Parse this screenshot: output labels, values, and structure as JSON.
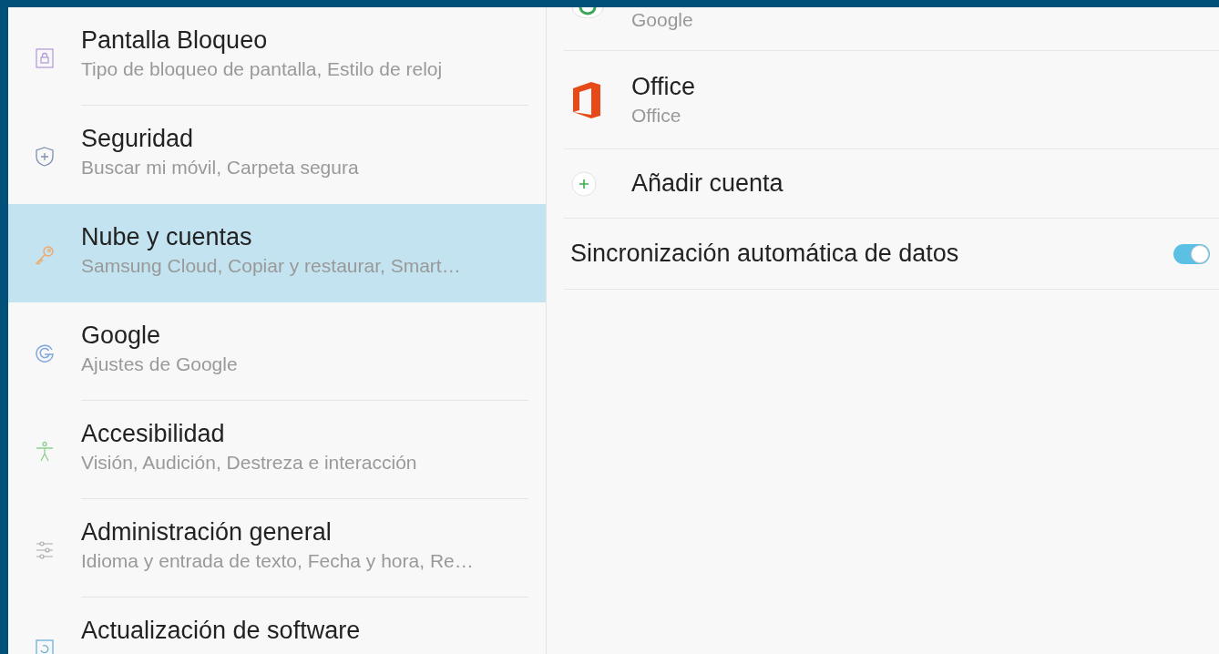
{
  "sidebar": {
    "items": [
      {
        "title": "Pantalla Bloqueo",
        "subtitle": "Tipo de bloqueo de pantalla, Estilo de reloj",
        "selected": false
      },
      {
        "title": "Seguridad",
        "subtitle": "Buscar mi móvil, Carpeta segura",
        "selected": false
      },
      {
        "title": "Nube y cuentas",
        "subtitle": "Samsung Cloud, Copiar y restaurar, Smart…",
        "selected": true
      },
      {
        "title": "Google",
        "subtitle": "Ajustes de Google",
        "selected": false
      },
      {
        "title": "Accesibilidad",
        "subtitle": "Visión, Audición, Destreza e interacción",
        "selected": false
      },
      {
        "title": "Administración general",
        "subtitle": "Idioma y entrada de texto, Fecha y hora, Re…",
        "selected": false
      },
      {
        "title": "Actualización de software",
        "selected": false
      }
    ]
  },
  "accounts": [
    {
      "subtitle": "Google"
    },
    {
      "title": "Office",
      "subtitle": "Office"
    }
  ],
  "add_account": {
    "label": "Añadir cuenta"
  },
  "auto_sync": {
    "label": "Sincronización automática de datos",
    "on": true
  }
}
